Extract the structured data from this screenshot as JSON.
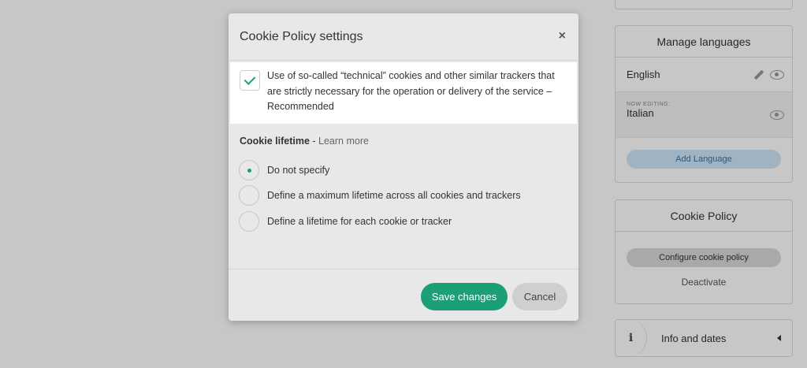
{
  "background": {
    "languages_panel": {
      "title": "Manage languages",
      "languages": [
        {
          "name": "English"
        },
        {
          "name": "Italian",
          "badge": "NOW EDITING:"
        }
      ],
      "add_language_label": "Add Language"
    },
    "cookie_panel": {
      "title": "Cookie Policy",
      "configure_label": "Configure cookie policy",
      "deactivate_label": "Deactivate"
    },
    "info_panel": {
      "icon": "i",
      "label": "Info and dates"
    }
  },
  "modal": {
    "title": "Cookie Policy settings",
    "close_icon": "×",
    "consent": {
      "checked": true,
      "text": "Use of so-called “technical” cookies and other similar trackers that are strictly necessary for the operation or delivery of the service – Recommended"
    },
    "lifetime": {
      "heading": "Cookie lifetime",
      "separator": " - ",
      "learn_more": "Learn more",
      "options": [
        {
          "label": "Do not specify",
          "selected": true
        },
        {
          "label": "Define a maximum lifetime across all cookies and trackers",
          "selected": false
        },
        {
          "label": "Define a lifetime for each cookie or tracker",
          "selected": false
        }
      ]
    },
    "save_label": "Save changes",
    "cancel_label": "Cancel"
  },
  "colors": {
    "accent_green": "#1b9f76",
    "overlay": "rgba(0,0,0,0.22)"
  }
}
